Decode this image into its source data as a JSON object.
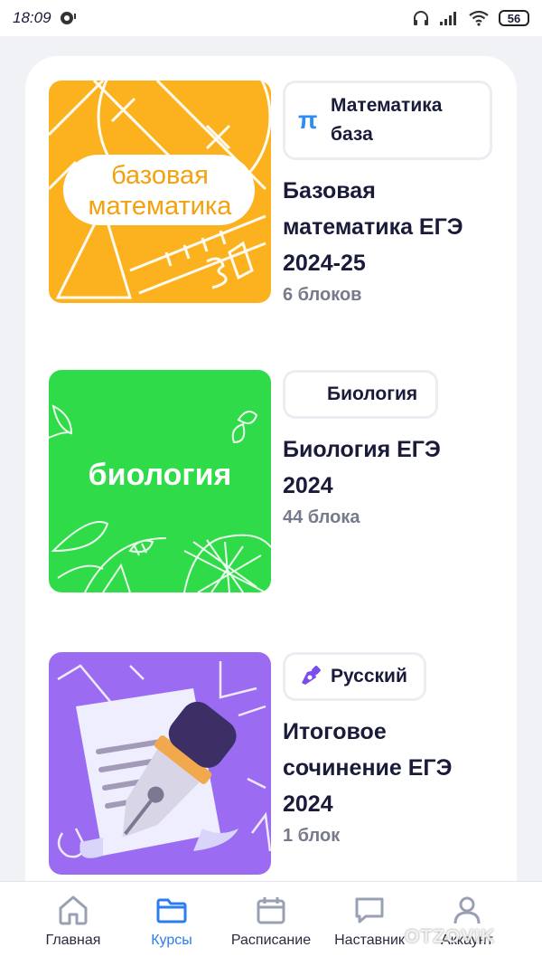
{
  "status_bar": {
    "time": "18:09",
    "battery": "56",
    "icons": [
      "record-icon",
      "headphones-icon",
      "signal-icon",
      "wifi-icon",
      "battery-icon"
    ]
  },
  "courses": [
    {
      "tag": {
        "label": "Математика база",
        "line1": "Математика",
        "line2": "база",
        "icon": "pi-icon",
        "icon_glyph": "π",
        "icon_color": "#2f8df2"
      },
      "thumb_text_1": "базовая",
      "thumb_text_2": "математика",
      "thumb_color": "#fbb21e",
      "title": "Базовая математика ЕГЭ 2024-25",
      "count": "6 блоков"
    },
    {
      "tag": {
        "label": "Биология"
      },
      "thumb_text_1": "биология",
      "thumb_color": "#2fdb48",
      "title": "Биология ЕГЭ 2024",
      "count": "44 блока"
    },
    {
      "tag": {
        "label": "Русский",
        "icon": "pen-icon",
        "icon_color": "#7c4dee"
      },
      "thumb_color": "#9b6cf2",
      "title": "Итоговое сочинение ЕГЭ 2024",
      "count": "1 блок"
    }
  ],
  "nav": {
    "items": [
      {
        "label": "Главная",
        "icon": "home-icon"
      },
      {
        "label": "Курсы",
        "icon": "folder-icon",
        "active": true
      },
      {
        "label": "Расписание",
        "icon": "calendar-icon"
      },
      {
        "label": "Наставник",
        "icon": "chat-icon"
      },
      {
        "label": "Аккаунт",
        "icon": "user-icon"
      }
    ],
    "active_color": "#2b7df0"
  },
  "watermark": "OTZOVIK"
}
